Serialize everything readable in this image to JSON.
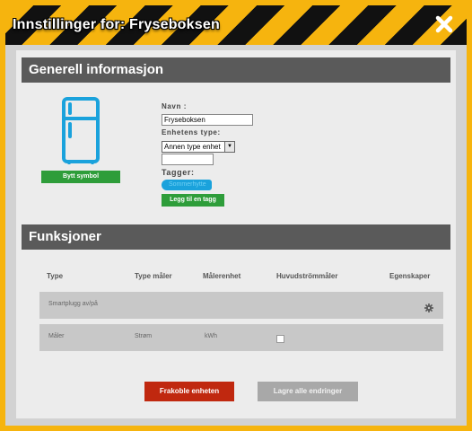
{
  "dialog": {
    "title": "Innstillinger for: Fryseboksen",
    "close_icon": "close-icon"
  },
  "general": {
    "header": "Generell informasjon",
    "device_icon": "fridge-icon",
    "change_symbol_label": "Bytt symbol",
    "name_label": "Navn :",
    "name_value": "Fryseboksen",
    "device_type_label": "Enhetens type:",
    "device_type_selected": "Annen type enhet",
    "device_type_extra_value": "",
    "tags_label": "Tagger:",
    "tags": [
      "Sommerhytte"
    ],
    "add_tag_label": "Legg til en tagg"
  },
  "functions": {
    "header": "Funksjoner",
    "columns": [
      "Type",
      "Type måler",
      "Målerenhet",
      "Huvudströmmåler",
      "Egenskaper"
    ],
    "rows": [
      {
        "type": "Smartplugg av/på",
        "meter_type": "",
        "unit": "",
        "main_meter": null,
        "has_settings": true
      },
      {
        "type": "Måler",
        "meter_type": "Strøm",
        "unit": "kWh",
        "main_meter": false,
        "has_settings": false
      }
    ]
  },
  "actions": {
    "disconnect_label": "Frakoble enheten",
    "save_label": "Lagre alle endringer"
  },
  "colors": {
    "accent_yellow": "#f6b40e",
    "green": "#2e9d3a",
    "red": "#c0280f",
    "blue_icon": "#1aa2dc",
    "section_header": "#5a5a5a"
  }
}
